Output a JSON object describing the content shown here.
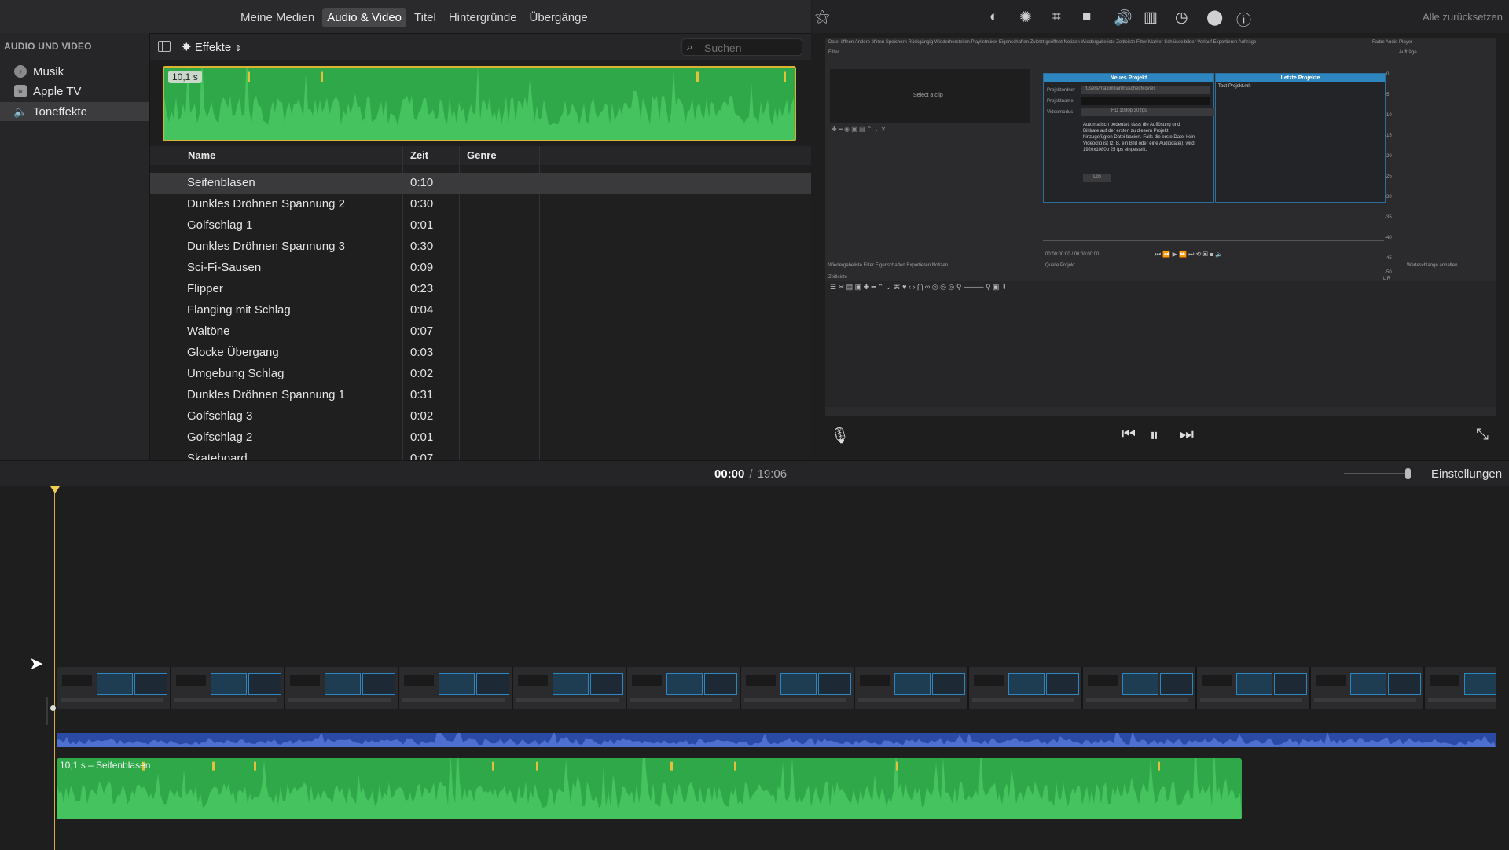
{
  "media_tabs": [
    "Meine Medien",
    "Audio & Video",
    "Titel",
    "Hintergründe",
    "Übergänge"
  ],
  "active_media_tab": "Audio & Video",
  "sidebar": {
    "header": "AUDIO UND VIDEO",
    "items": [
      {
        "label": "Musik",
        "icon": "music-icon"
      },
      {
        "label": "Apple TV",
        "icon": "appletv-icon"
      },
      {
        "label": "Toneffekte",
        "icon": "speaker-icon",
        "selected": true
      }
    ]
  },
  "browser": {
    "effects_label": "Effekte",
    "search_placeholder": "Suchen",
    "duration_badge": "10,1 s"
  },
  "table": {
    "columns": [
      "Name",
      "Zeit",
      "Genre"
    ],
    "rows": [
      {
        "name": "Seifenblasen",
        "time": "0:10",
        "selected": true
      },
      {
        "name": "Dunkles Dröhnen Spannung 2",
        "time": "0:30"
      },
      {
        "name": "Golfschlag 1",
        "time": "0:01"
      },
      {
        "name": "Dunkles Dröhnen Spannung 3",
        "time": "0:30"
      },
      {
        "name": "Sci-Fi-Sausen",
        "time": "0:09"
      },
      {
        "name": "Flipper",
        "time": "0:23"
      },
      {
        "name": "Flanging mit Schlag",
        "time": "0:04"
      },
      {
        "name": "Waltöne",
        "time": "0:07"
      },
      {
        "name": "Glocke Übergang",
        "time": "0:03"
      },
      {
        "name": "Umgebung Schlag",
        "time": "0:02"
      },
      {
        "name": "Dunkles Dröhnen Spannung 1",
        "time": "0:31"
      },
      {
        "name": "Golfschlag 3",
        "time": "0:02"
      },
      {
        "name": "Golfschlag 2",
        "time": "0:01"
      },
      {
        "name": "Skateboard",
        "time": "0:07"
      }
    ]
  },
  "inspector": {
    "icons": [
      "magic-wand-icon",
      "color-balance-icon",
      "color-palette-icon",
      "crop-icon",
      "camera-stabilize-icon",
      "volume-icon",
      "equalizer-icon",
      "speed-icon",
      "filter-icon",
      "info-icon"
    ],
    "reset_label": "Alle zurücksetzen"
  },
  "viewer": {
    "mini_screen": {
      "top_tabs": "Datei öffnen   Andere öffnen   Speichern   Rückgängig   Wiederherstellen   Playlistmixer   Eigenschaften   Zuletzt geöffnet   Notizen   Wiedergabeliste   Zeitleiste   Filter   Marker   Schlüsselbilder   Verlauf   Exportieren   Aufträge",
      "top_right": "Farbe   Audio   Player",
      "filter_label": "Filter",
      "right_label": "Aufträge",
      "select_clip": "Select a clip",
      "new_project": {
        "title": "Neues Projekt",
        "folder_label": "Projektordner",
        "folder_value": "/Users/maximilianmuschel/Movies",
        "name_label": "Projektname",
        "mode_label": "Videomodus",
        "mode_value": "HD 1080p 30 fps",
        "desc_1": "Automatisch bedeutet, dass die Auflösung und",
        "desc_2": "Bildrate auf der ersten zu diesem Projekt",
        "desc_3": "hinzugefügten Datei basiert. Falls die erste Datei kein",
        "desc_4": "Videoclip ist (z. B. ein Bild oder eine Audiodatei), wird",
        "desc_5": "1920x1080p 25 fps eingestellt.",
        "start_button": "Los"
      },
      "recent_projects": {
        "title": "Letzte Projekte",
        "item": "Test-Projekt.mlt"
      },
      "timecode": "00:00:00:00  /  00:00:00:00",
      "bottom_tabs": "Wiedergabeliste   Filter   Eigenschaften   Exportieren   Notizen",
      "source_tabs": "Quelle   Projekt",
      "queue_label": "Warteschlange anhalten",
      "timeline_label": "Zeitleiste",
      "meter_labels": [
        "0",
        "-5",
        "-10",
        "-15",
        "-20",
        "-25",
        "-30",
        "-35",
        "-40",
        "-45",
        "-50",
        "L R"
      ]
    }
  },
  "timeline": {
    "current": "00:00",
    "separator": "/",
    "total": "19:06",
    "settings_label": "Einstellungen",
    "audio_clip_label": "10,1 s – Seifenblasen",
    "thumbnail_count": 13
  },
  "colors": {
    "audio_green": "#2fa84a",
    "audio_blue": "#2b4aa6",
    "playhead": "#dcb233",
    "selection_outline": "#dcb233"
  }
}
